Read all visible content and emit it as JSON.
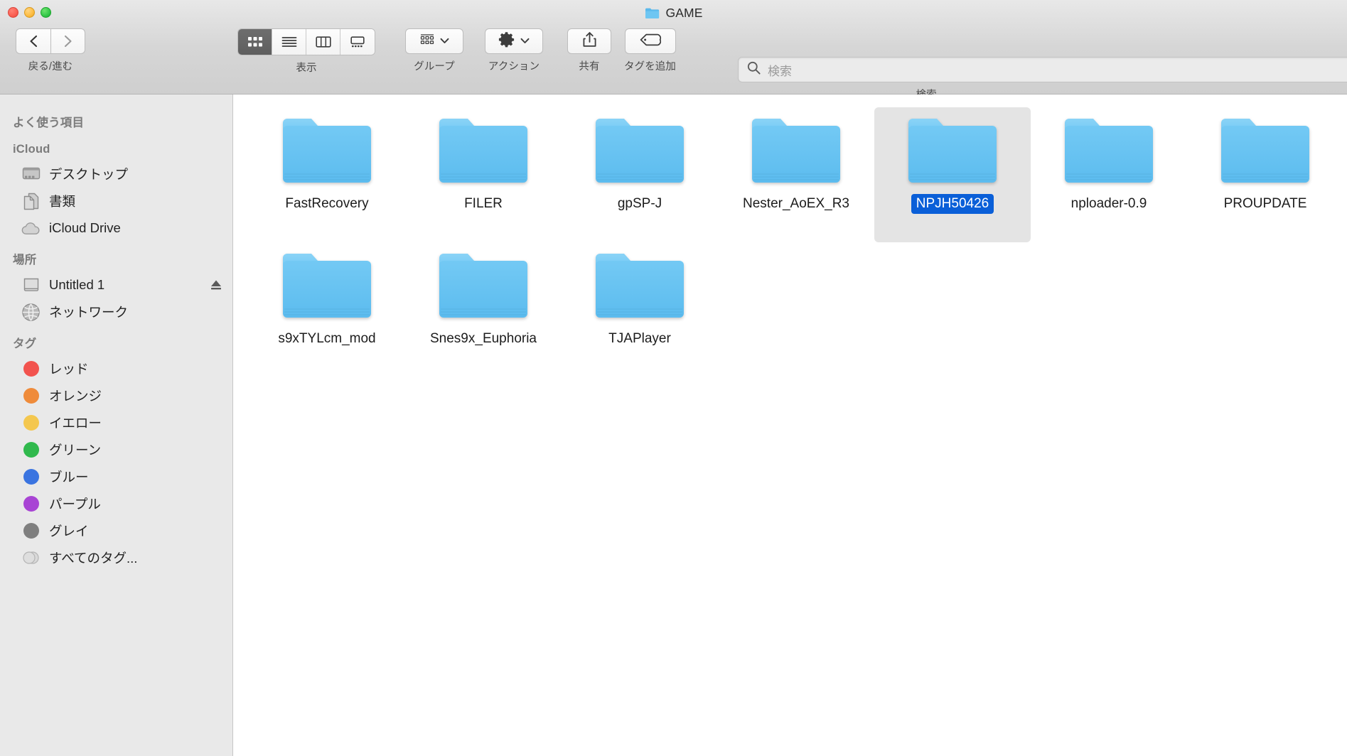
{
  "window": {
    "title": "GAME",
    "title_icon": "folder-icon",
    "traffic_lights": [
      {
        "name": "close-button",
        "color": "#fa5f52"
      },
      {
        "name": "minimize-button",
        "color": "#fdbc40"
      },
      {
        "name": "zoom-button",
        "color": "#34c749"
      }
    ]
  },
  "toolbar": {
    "nav": {
      "label": "戻る/進む",
      "back_icon": "chevron-left-icon",
      "forward_icon": "chevron-right-icon"
    },
    "view": {
      "label": "表示",
      "modes": [
        {
          "name": "icon-view",
          "icon": "grid-icon",
          "active": true
        },
        {
          "name": "list-view",
          "icon": "list-icon",
          "active": false
        },
        {
          "name": "column-view",
          "icon": "columns-icon",
          "active": false
        },
        {
          "name": "gallery-view",
          "icon": "gallery-icon",
          "active": false
        }
      ]
    },
    "group": {
      "label": "グループ",
      "icon": "grid-small-icon",
      "chevron": "chevron-down-icon"
    },
    "action": {
      "label": "アクション",
      "icon": "gear-icon",
      "chevron": "chevron-down-icon"
    },
    "share": {
      "label": "共有",
      "icon": "share-icon"
    },
    "tag": {
      "label": "タグを追加",
      "icon": "tag-icon"
    }
  },
  "search": {
    "label": "検索",
    "placeholder": "検索",
    "value": "",
    "icon": "search-icon"
  },
  "sidebar": {
    "sections": [
      {
        "header": "よく使う項目",
        "items": []
      },
      {
        "header": "iCloud",
        "items": [
          {
            "label": "デスクトップ",
            "icon": "desktop-icon"
          },
          {
            "label": "書類",
            "icon": "documents-icon"
          },
          {
            "label": "iCloud Drive",
            "icon": "cloud-icon"
          }
        ]
      },
      {
        "header": "場所",
        "items": [
          {
            "label": "Untitled 1",
            "icon": "external-drive-icon",
            "eject": "eject-icon"
          },
          {
            "label": "ネットワーク",
            "icon": "network-globe-icon"
          }
        ]
      },
      {
        "header": "タグ",
        "items": [
          {
            "label": "レッド",
            "icon": "tag-dot-icon",
            "color": "#f2534e"
          },
          {
            "label": "オレンジ",
            "icon": "tag-dot-icon",
            "color": "#ef8b3a"
          },
          {
            "label": "イエロー",
            "icon": "tag-dot-icon",
            "color": "#f5c council"
          },
          {
            "label": "グリーン",
            "icon": "tag-dot-icon",
            "color": "#30b94d"
          },
          {
            "label": "ブルー",
            "icon": "tag-dot-icon",
            "color": "#3a74e0"
          },
          {
            "label": "パープル",
            "icon": "tag-dot-icon",
            "color": "#a844d4"
          },
          {
            "label": "グレイ",
            "icon": "tag-dot-icon",
            "color": "#7f7f7f"
          },
          {
            "label": "すべてのタグ...",
            "icon": "all-tags-icon",
            "color": "#d4d4d4"
          }
        ]
      }
    ]
  },
  "content": {
    "view_mode": "icon-view",
    "items": [
      {
        "name": "FastRecovery",
        "icon": "folder-icon",
        "selected": false
      },
      {
        "name": "FILER",
        "icon": "folder-icon",
        "selected": false
      },
      {
        "name": "gpSP-J",
        "icon": "folder-icon",
        "selected": false
      },
      {
        "name": "Nester_AoEX_R3",
        "icon": "folder-icon",
        "selected": false
      },
      {
        "name": "NPJH50426",
        "icon": "folder-icon",
        "selected": true
      },
      {
        "name": "nploader-0.9",
        "icon": "folder-icon",
        "selected": false
      },
      {
        "name": "PROUPDATE",
        "icon": "folder-icon",
        "selected": false
      },
      {
        "name": "s9xTYLcm_mod",
        "icon": "folder-icon",
        "selected": false
      },
      {
        "name": "Snes9x_Euphoria",
        "icon": "folder-icon",
        "selected": false
      },
      {
        "name": "TJAPlayer",
        "icon": "folder-icon",
        "selected": false
      }
    ]
  },
  "colors": {
    "selection_blue": "#0a5fd8",
    "selection_bg": "#e4e4e4",
    "folder_blue": "#62bdf0",
    "sidebar_bg": "#e9e9e9",
    "chrome_bg": "#d6d6d6"
  }
}
